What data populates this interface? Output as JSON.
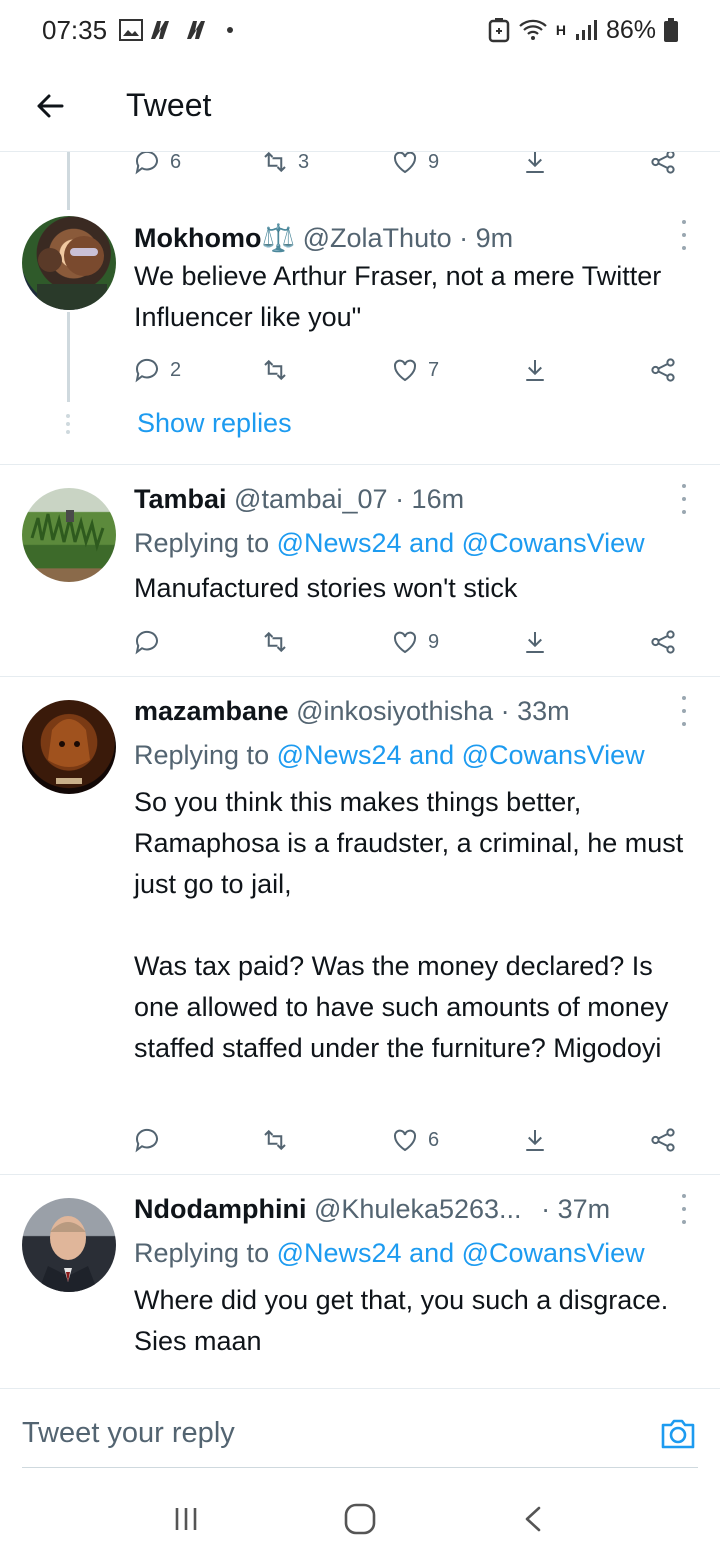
{
  "status_bar": {
    "time": "07:35",
    "battery": "86%",
    "network": "H"
  },
  "header": {
    "title": "Tweet"
  },
  "top_partial_actions": {
    "reply_count": "6",
    "retweet_count": "3",
    "like_count": "9"
  },
  "tweets": [
    {
      "name": "Mokhomo⚖️",
      "handle": "@ZolaThuto",
      "time": "· 9m",
      "body": "We believe Arthur Fraser, not a mere Twitter Influencer like you\"",
      "reply_count": "2",
      "retweet_count": "",
      "like_count": "7"
    },
    {
      "name": "Tambai",
      "handle": "@tambai_07",
      "time": "· 16m",
      "replying_prefix": "Replying to",
      "replying_to": "@News24 and @CowansView",
      "body": "Manufactured stories won't stick",
      "reply_count": "",
      "retweet_count": "",
      "like_count": "9"
    },
    {
      "name": "mazambane",
      "handle": "@inkosiyothisha",
      "time": "· 33m",
      "replying_prefix": "Replying to",
      "replying_to": "@News24 and @CowansView",
      "body": "So you think this makes things better, Ramaphosa is a fraudster, a criminal, he must just go to jail,\n\nWas tax paid? Was the money declared? Is one allowed to have such amounts of money staffed staffed under the furniture? Migodoyi",
      "reply_count": "",
      "retweet_count": "",
      "like_count": "6"
    },
    {
      "name": "Ndodamphini",
      "handle": "@Khuleka5263...",
      "time": "· 37m",
      "replying_prefix": "Replying to",
      "replying_to": "@News24 and @CowansView",
      "body": "Where did you get that, you such a disgrace. Sies maan"
    }
  ],
  "show_replies": "Show replies",
  "reply_bar": {
    "placeholder": "Tweet your reply"
  },
  "colors": {
    "accent": "#1d9bf0",
    "text": "#0f1419",
    "secondary": "#536471"
  }
}
